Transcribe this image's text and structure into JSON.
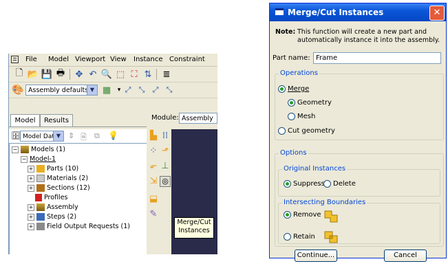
{
  "cae": {
    "menu": [
      "File",
      "Model",
      "Viewport",
      "View",
      "Instance",
      "Constraint"
    ],
    "assembly_defaults": "Assembly defaults",
    "tabs": [
      "Model",
      "Results"
    ],
    "module_label": "Module:",
    "module_value": "Assembly",
    "model_db": "Model Datat",
    "tree": [
      {
        "label": "Models (1)",
        "sign": "−"
      },
      {
        "label": "Model-1",
        "sign": "−"
      },
      {
        "label": "Parts (10)",
        "sign": "+"
      },
      {
        "label": "Materials (2)",
        "sign": "+"
      },
      {
        "label": "Sections (12)",
        "sign": "+"
      },
      {
        "label": "Profiles",
        "sign": ""
      },
      {
        "label": "Assembly",
        "sign": "+"
      },
      {
        "label": "Steps (2)",
        "sign": "+"
      },
      {
        "label": "Field Output Requests (1)",
        "sign": "+"
      }
    ],
    "tooltip_line1": "Merge/Cut",
    "tooltip_line2": "Instances"
  },
  "dialog": {
    "title": "Merge/Cut Instances",
    "note_label": "Note:",
    "note_line1": "This function will create a new part and",
    "note_line2": "automatically instance it into the assembly.",
    "part_name_label": "Part name:",
    "part_name_value": "Frame",
    "operations_label": "Operations",
    "merge": "Merge",
    "geometry": "Geometry",
    "mesh": "Mesh",
    "cut_geometry": "Cut geometry",
    "options_label": "Options",
    "original_instances_label": "Original Instances",
    "suppress": "Suppress",
    "delete": "Delete",
    "intersecting_boundaries_label": "Intersecting Boundaries",
    "remove": "Remove",
    "retain": "Retain",
    "continue": "Continue...",
    "cancel": "Cancel",
    "close_glyph": "✕"
  },
  "colors": {
    "accent": "#0a57d8",
    "viewport": "#2a2a4a",
    "shape": "#f2c12e"
  }
}
